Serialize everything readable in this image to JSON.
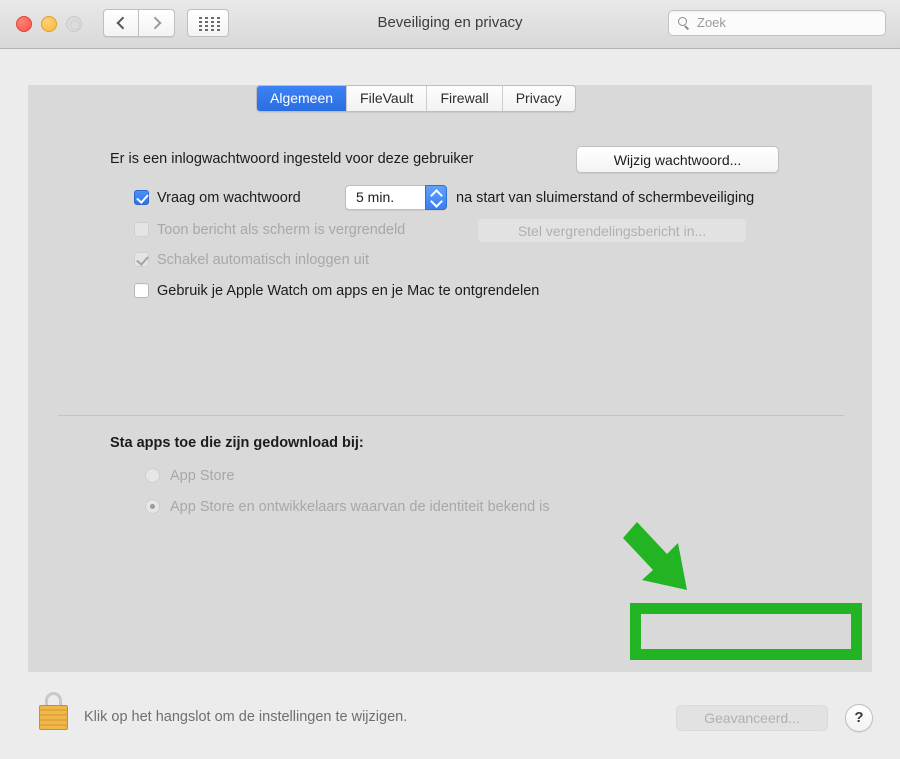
{
  "window": {
    "title": "Beveiliging en privacy",
    "traffic_lights": [
      "close",
      "minimize",
      "zoom"
    ],
    "nav": {
      "back": "‹",
      "forward": "›"
    },
    "grid_button": "show-all-preferences"
  },
  "search": {
    "placeholder": "Zoek",
    "value": ""
  },
  "tabs": [
    {
      "label": "Algemeen",
      "selected": true
    },
    {
      "label": "FileVault",
      "selected": false
    },
    {
      "label": "Firewall",
      "selected": false
    },
    {
      "label": "Privacy",
      "selected": false
    }
  ],
  "general": {
    "password_set_label": "Er is een inlogwachtwoord ingesteld voor deze gebruiker",
    "change_password_button": "Wijzig wachtwoord...",
    "require_password": {
      "checked": true,
      "enabled": true,
      "label_before": "Vraag om wachtwoord",
      "delay_value": "5 min.",
      "label_after": "na start van sluimerstand of schermbeveiliging"
    },
    "lock_message": {
      "checked": false,
      "enabled": false,
      "label": "Toon bericht als scherm is vergrendeld",
      "button": "Stel vergrendelingsbericht in..."
    },
    "disable_auto_login": {
      "checked": true,
      "enabled": false,
      "label": "Schakel automatisch inloggen uit"
    },
    "apple_watch": {
      "checked": false,
      "enabled": true,
      "label": "Gebruik je Apple Watch om apps en je Mac te ontgrendelen"
    }
  },
  "downloads": {
    "heading": "Sta apps toe die zijn gedownload bij:",
    "options": [
      {
        "label": "App Store",
        "selected": false,
        "enabled": false
      },
      {
        "label": "App Store en ontwikkelaars waarvan de identiteit bekend is",
        "selected": true,
        "enabled": false
      }
    ]
  },
  "annotation": {
    "color": "#22b422",
    "shapes": [
      "arrow",
      "rectangle"
    ]
  },
  "footer": {
    "lock_state": "locked",
    "lock_caption": "Klik op het hangslot om de instellingen te wijzigen.",
    "advanced_button": "Geavanceerd...",
    "advanced_enabled": false,
    "help_button": "?"
  }
}
